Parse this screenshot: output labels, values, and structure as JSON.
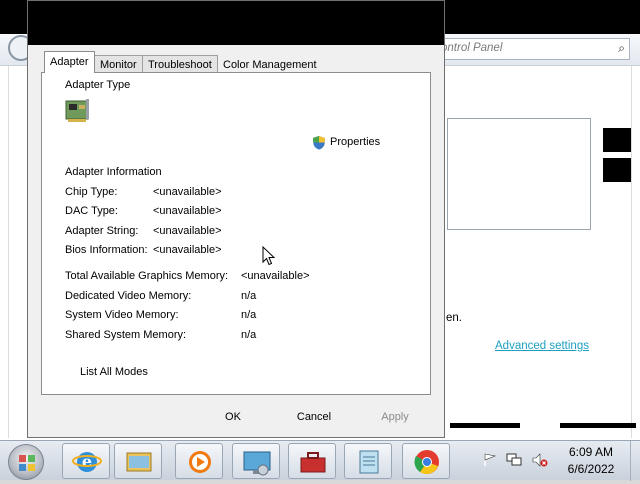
{
  "background_window": {
    "search_placeholder": "ontrol Panel",
    "visible_text_fragment": "en.",
    "advanced_settings_link": "Advanced settings"
  },
  "dialog": {
    "tabs": [
      {
        "label": "Adapter",
        "selected": true
      },
      {
        "label": "Monitor",
        "selected": false
      },
      {
        "label": "Troubleshoot",
        "selected": false
      },
      {
        "label": "Color Management",
        "selected": false
      }
    ],
    "adapter_type_heading": "Adapter Type",
    "properties_button": "Properties",
    "adapter_info_heading": "Adapter Information",
    "adapter_info": [
      {
        "label": "Chip Type:",
        "value": "<unavailable>"
      },
      {
        "label": "DAC Type:",
        "value": "<unavailable>"
      },
      {
        "label": "Adapter String:",
        "value": "<unavailable>"
      },
      {
        "label": "Bios Information:",
        "value": "<unavailable>"
      }
    ],
    "memory_info": [
      {
        "label": "Total Available Graphics Memory:",
        "value": "<unavailable>"
      },
      {
        "label": "Dedicated Video Memory:",
        "value": "n/a"
      },
      {
        "label": "System Video Memory:",
        "value": "n/a"
      },
      {
        "label": "Shared System Memory:",
        "value": "n/a"
      }
    ],
    "list_all_modes_button": "List All Modes",
    "ok_button": "OK",
    "cancel_button": "Cancel",
    "apply_button": "Apply",
    "apply_enabled": false
  },
  "taskbar": {
    "items": [
      "internet-explorer-icon",
      "windows-explorer-icon",
      "media-player-icon",
      "display-settings-icon",
      "toolbox-icon",
      "notepad-icon",
      "chrome-icon"
    ],
    "tray_icons": [
      "action-center-flag-icon",
      "network-icon",
      "volume-muted-icon"
    ],
    "clock_time": "6:09 AM",
    "clock_date": "6/6/2022"
  },
  "colors": {
    "link": "#20a0c0",
    "dialog_bg": "#f0f0f0",
    "disabled_text": "#8a8a8a"
  }
}
